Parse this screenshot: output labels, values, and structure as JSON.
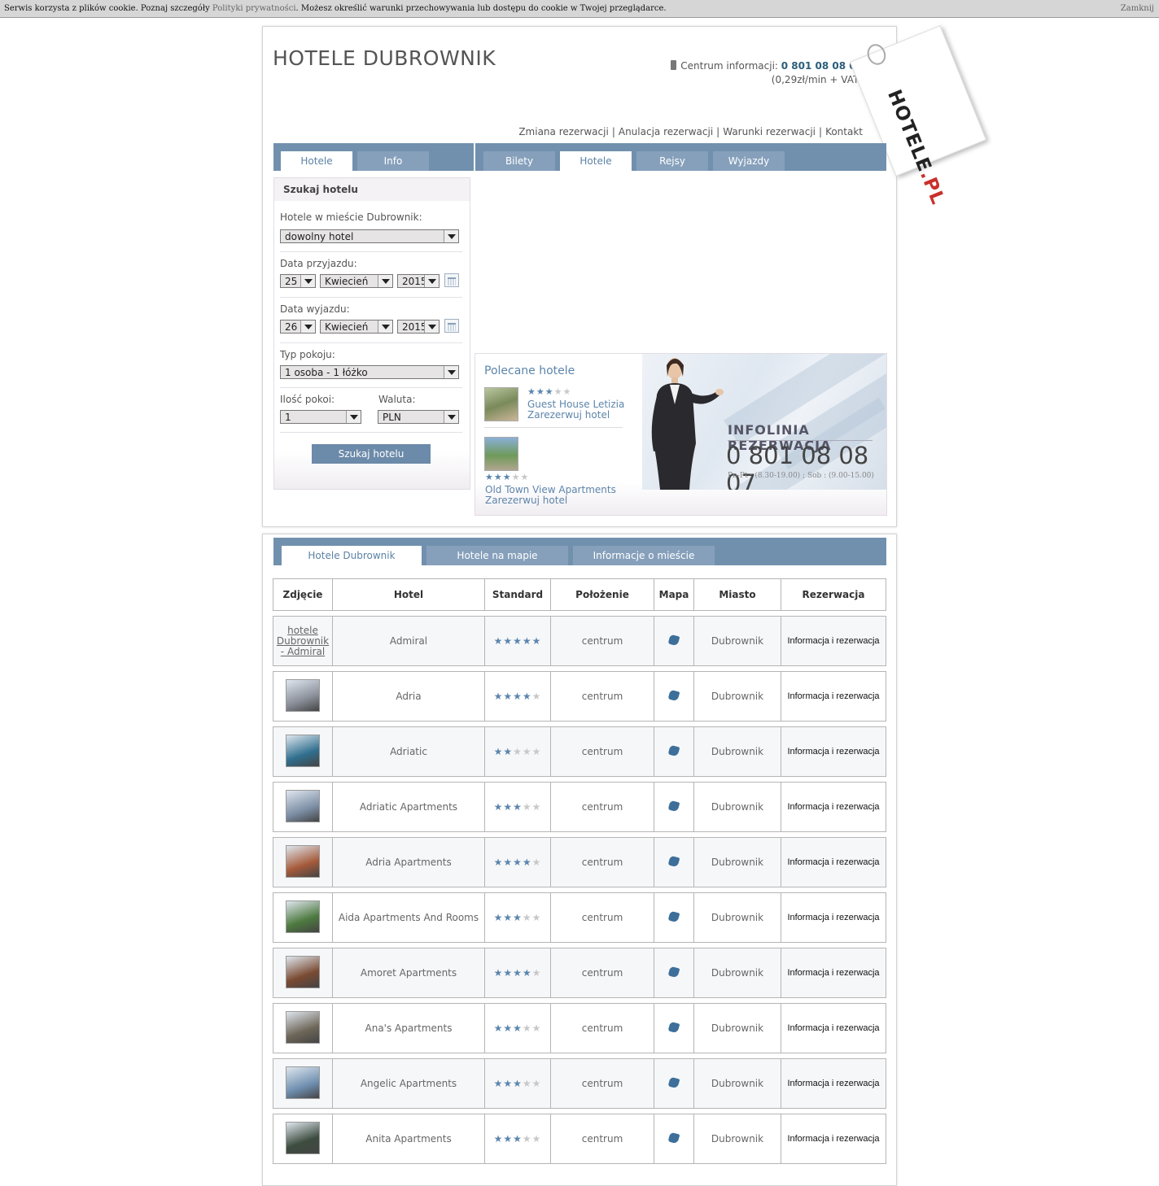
{
  "cookie": {
    "text_before": "Serwis korzysta z plików cookie. Poznaj szczegóły ",
    "link": "Polityki prywatności",
    "text_after": ". Możesz określić warunki przechowywania lub dostępu do cookie w Twojej przeglądarce.",
    "close": "Zamknij"
  },
  "header": {
    "title": "HOTELE DUBROWNIK",
    "info_label": "Centrum informacji:",
    "phone": "0 801 08 08 07",
    "price": "(0,29zł/min + VAT)",
    "links": [
      "Zmiana rezerwacji",
      "Anulacja rezerwacji",
      "Warunki rezerwacji",
      "Kontakt"
    ],
    "tag_brand_a": "HOTELE",
    "tag_brand_b": ".PL"
  },
  "left_tabs": [
    "Hotele",
    "Info"
  ],
  "right_tabs": [
    "Bilety",
    "Hotele",
    "Rejsy",
    "Wyjazdy"
  ],
  "search": {
    "title": "Szukaj hotelu",
    "city_label": "Hotele w mieście Dubrownik:",
    "city_value": "dowolny hotel",
    "arrival_label": "Data przyjazdu:",
    "arrival_day": "25",
    "arrival_month": "Kwiecień",
    "arrival_year": "2015",
    "departure_label": "Data wyjazdu:",
    "departure_day": "26",
    "departure_month": "Kwiecień",
    "departure_year": "2015",
    "room_type_label": "Typ pokoju:",
    "room_type_value": "1 osoba - 1 łóżko",
    "rooms_label": "Ilość pokoi:",
    "rooms_value": "1",
    "currency_label": "Waluta:",
    "currency_value": "PLN",
    "button": "Szukaj hotelu"
  },
  "recommended": {
    "title": "Polecane hotele",
    "items": [
      {
        "name": "Guest House Letizia",
        "link": "Zarezerwuj hotel",
        "stars": 3
      },
      {
        "name": "Old Town View Apartments",
        "link": "Zarezerwuj hotel",
        "stars": 3
      }
    ]
  },
  "banner": {
    "title": "INFOLINIA REZERWACJA",
    "phone": "0 801 08 08 07",
    "hours": "Pn-Pt : (8.30-19.00) ;  Sob : (9.00-15.00)"
  },
  "bottom_tabs": [
    "Hotele Dubrownik",
    "Hotele na mapie",
    "Informacje o mieście"
  ],
  "table": {
    "headers": [
      "Zdjęcie",
      "Hotel",
      "Standard",
      "Położenie",
      "Mapa",
      "Miasto",
      "Rezerwacja"
    ],
    "first_alt": "hotele Dubrownik - Admiral",
    "rows": [
      {
        "name": "Admiral",
        "stars": 5,
        "location": "centrum",
        "city": "Dubrownik",
        "reserve": "Informacja i rezerwacja",
        "color": "#ffffff"
      },
      {
        "name": "Adria",
        "stars": 4,
        "location": "centrum",
        "city": "Dubrownik",
        "reserve": "Informacja i rezerwacja",
        "color": "#8a8f99"
      },
      {
        "name": "Adriatic",
        "stars": 2,
        "location": "centrum",
        "city": "Dubrownik",
        "reserve": "Informacja i rezerwacja",
        "color": "#2f6f8f"
      },
      {
        "name": "Adriatic Apartments",
        "stars": 3,
        "location": "centrum",
        "city": "Dubrownik",
        "reserve": "Informacja i rezerwacja",
        "color": "#7d8fa6"
      },
      {
        "name": "Adria Apartments",
        "stars": 4,
        "location": "centrum",
        "city": "Dubrownik",
        "reserve": "Informacja i rezerwacja",
        "color": "#a55a3a"
      },
      {
        "name": "Aida Apartments And Rooms",
        "stars": 3,
        "location": "centrum",
        "city": "Dubrownik",
        "reserve": "Informacja i rezerwacja",
        "color": "#4d7a3f"
      },
      {
        "name": "Amoret Apartments",
        "stars": 4,
        "location": "centrum",
        "city": "Dubrownik",
        "reserve": "Informacja i rezerwacja",
        "color": "#7a4a32"
      },
      {
        "name": "Ana's Apartments",
        "stars": 3,
        "location": "centrum",
        "city": "Dubrownik",
        "reserve": "Informacja i rezerwacja",
        "color": "#6e6658"
      },
      {
        "name": "Angelic Apartments",
        "stars": 3,
        "location": "centrum",
        "city": "Dubrownik",
        "reserve": "Informacja i rezerwacja",
        "color": "#6f8fb0"
      },
      {
        "name": "Anita Apartments",
        "stars": 3,
        "location": "centrum",
        "city": "Dubrownik",
        "reserve": "Informacja i rezerwacja",
        "color": "#3d4d3f"
      }
    ]
  }
}
